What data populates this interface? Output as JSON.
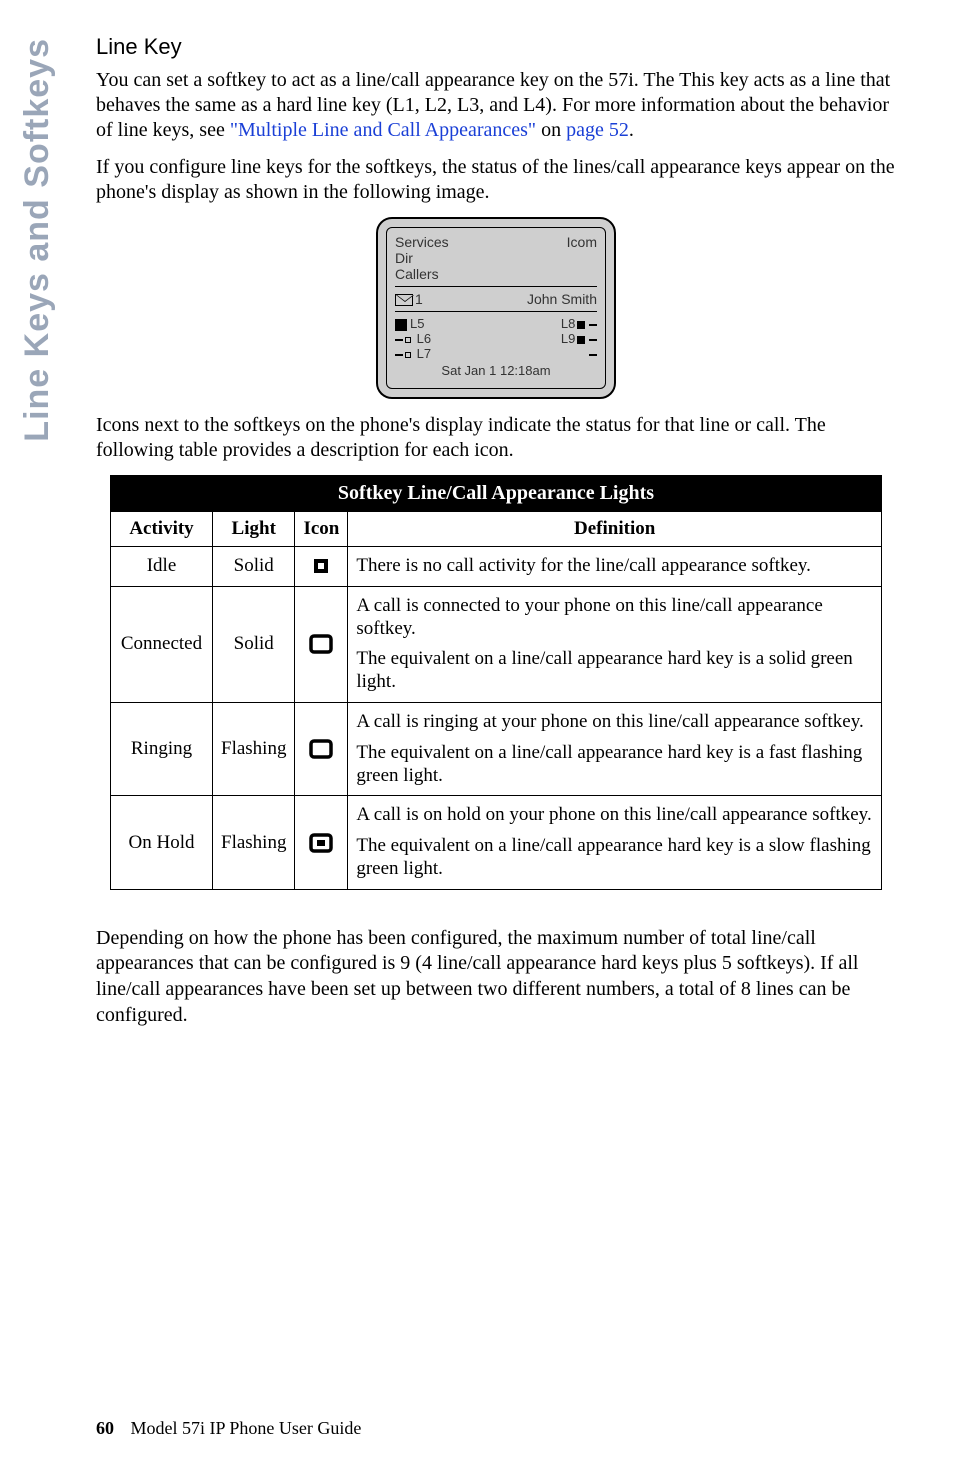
{
  "side_tab": "Line Keys and Softkeys",
  "heading": "Line Key",
  "para1_a": "You can set a softkey to act as a line/call appearance key on the 57i. The This key acts as a line that behaves the same as a hard line key (L1, L2, L3, and L4). For more information about the behavior of line keys, see ",
  "para1_link1": "\"Multiple Line and Call Appearances\"",
  "para1_b": " on ",
  "para1_link2": "page 52",
  "para1_c": ".",
  "para2": "If you configure line keys for the softkeys, the status of the lines/call appearance keys appear on the phone's display as shown in the following image.",
  "phone": {
    "services": "Services",
    "icom": "Icom",
    "dir": "Dir",
    "callers": "Callers",
    "msg_count": "1",
    "name": "John Smith",
    "l5": "L5",
    "l6": "L6",
    "l7": "L7",
    "l8": "L8",
    "l9": "L9",
    "datetime": "Sat  Jan 1  12:18am"
  },
  "para3": "Icons next to the softkeys on the phone's display indicate the status for that line or call. The following table provides a description for each icon.",
  "table": {
    "title": "Softkey Line/Call Appearance Lights",
    "headers": {
      "activity": "Activity",
      "light": "Light",
      "icon": "Icon",
      "definition": "Definition"
    },
    "rows": [
      {
        "activity": "Idle",
        "light": "Solid",
        "def": [
          "There is no call activity for the line/call appearance softkey."
        ]
      },
      {
        "activity": "Connected",
        "light": "Solid",
        "def": [
          "A call is connected to your phone on this line/call appearance softkey.",
          "The equivalent on a line/call appearance hard key is a solid green light."
        ]
      },
      {
        "activity": "Ringing",
        "light": "Flashing",
        "def": [
          "A call is ringing at your phone on this line/call appearance softkey.",
          "The equivalent on a line/call appearance hard key is a fast flashing green light."
        ]
      },
      {
        "activity": "On Hold",
        "light": "Flashing",
        "def": [
          "A call is on hold on your phone on this line/call appearance softkey.",
          "The equivalent on a line/call appearance hard key is a slow flashing green light."
        ]
      }
    ]
  },
  "para4": "Depending on how the phone has been configured, the maximum number of total line/call appearances that can be configured is 9 (4 line/call appearance hard keys plus 5 softkeys). If all line/call appearances have been set up between two different numbers, a total of 8 lines can be configured.",
  "footer": {
    "page": "60",
    "title": "Model 57i IP Phone User Guide"
  }
}
